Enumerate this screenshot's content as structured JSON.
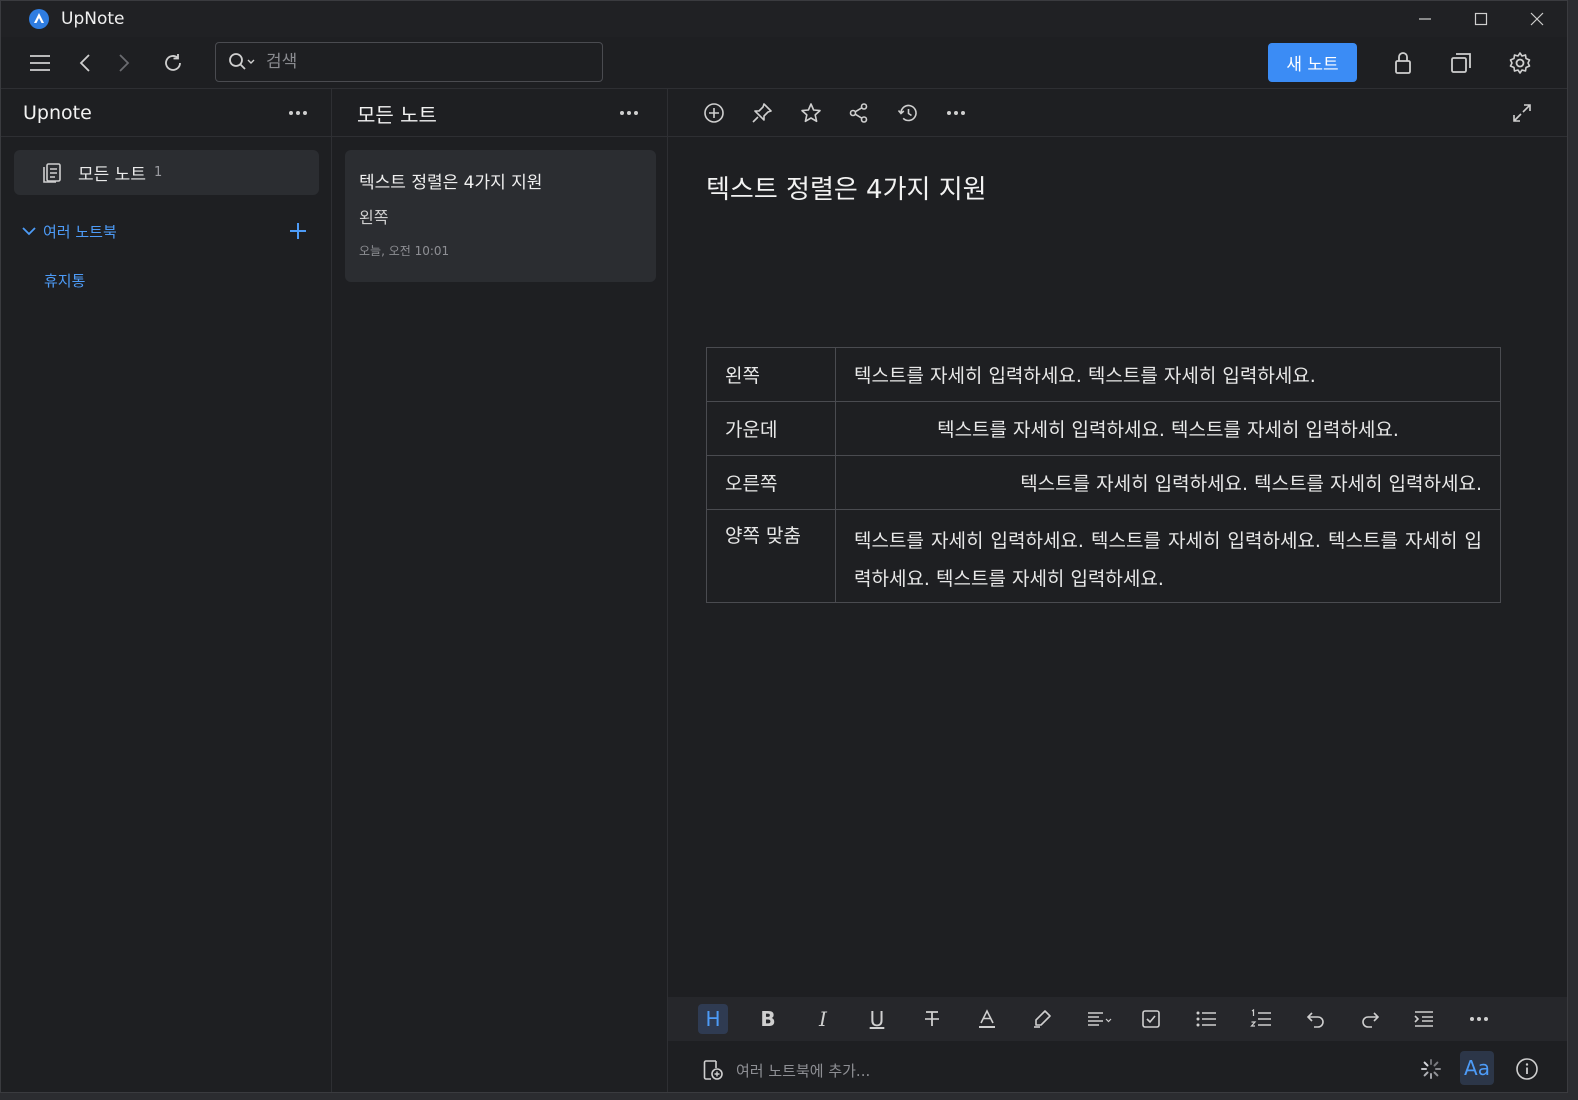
{
  "window": {
    "title": "UpNote"
  },
  "toolbar": {
    "search_placeholder": "검색",
    "new_note_label": "새 노트"
  },
  "sidebar": {
    "title": "Upnote",
    "all_notes": {
      "label": "모든 노트",
      "count": "1"
    },
    "notebooks_label": "여러 노트북",
    "trash_label": "휴지통"
  },
  "notelist": {
    "title": "모든 노트",
    "notes": [
      {
        "title": "텍스트 정렬은 4가지 지원",
        "preview": "왼쪽",
        "date": "오늘, 오전 10:01"
      }
    ]
  },
  "editor": {
    "title": "텍스트 정렬은 4가지 지원",
    "table": [
      {
        "header": "왼쪽",
        "text": "텍스트를 자세히 입력하세요. 텍스트를 자세히 입력하세요.",
        "align": "left"
      },
      {
        "header": "가운데",
        "text": "텍스트를 자세히 입력하세요. 텍스트를 자세히 입력하세요.",
        "align": "center"
      },
      {
        "header": "오른쪽",
        "text": "텍스트를 자세히 입력하세요. 텍스트를 자세히 입력하세요.",
        "align": "right"
      },
      {
        "header": "양쪽 맞춤",
        "text": "텍스트를 자세히 입력하세요. 텍스트를 자세히 입력하세요. 텍스트를 자세히 입력하세요. 텍스트를 자세히 입력하세요.",
        "align": "justify"
      }
    ],
    "format_buttons": {
      "heading": "H",
      "bold": "B",
      "italic": "I",
      "underline": "U"
    },
    "add_notebook_placeholder": "여러 노트북에 추가...",
    "font_button": "Aa"
  },
  "colors": {
    "accent": "#3b8cf5",
    "link": "#4d9bf7",
    "background": "#1e1f22",
    "card": "#2b2d31"
  }
}
